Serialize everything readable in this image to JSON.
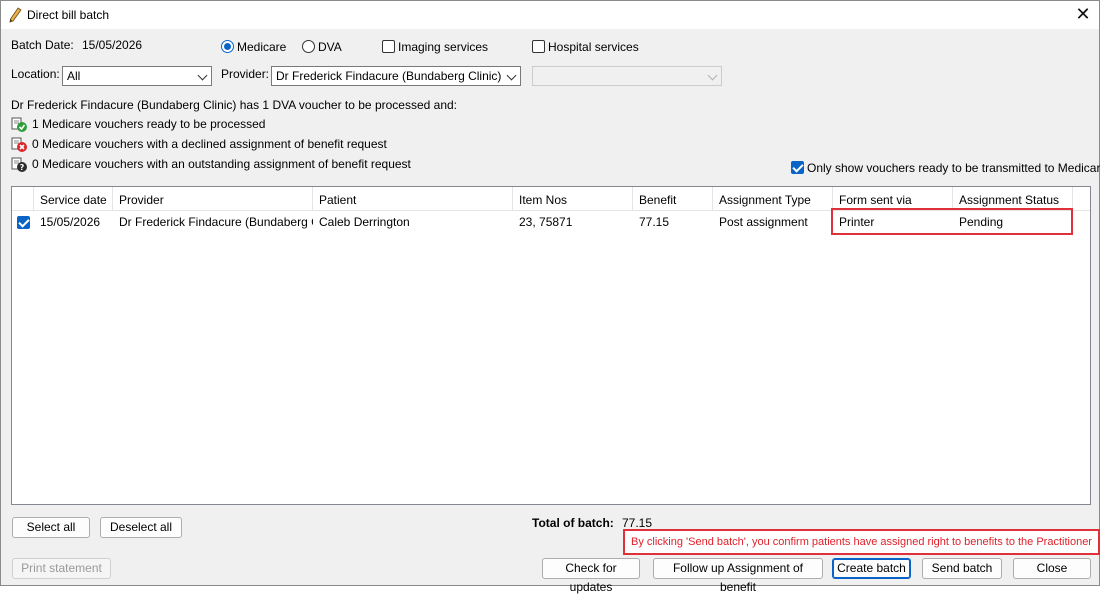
{
  "window": {
    "title": "Direct bill batch"
  },
  "batch": {
    "date_label": "Batch Date:",
    "date_value": "15/05/2026"
  },
  "options": {
    "medicare": "Medicare",
    "dva": "DVA",
    "imaging": "Imaging services",
    "hospital": "Hospital services"
  },
  "location": {
    "label": "Location:",
    "value": "All"
  },
  "provider": {
    "label": "Provider:",
    "value": "Dr Frederick Findacure (Bundaberg Clinic)"
  },
  "summary": {
    "heading": "Dr Frederick Findacure (Bundaberg Clinic) has 1 DVA voucher to be processed and:",
    "ready": "1 Medicare vouchers ready to be processed",
    "declined": "0 Medicare vouchers with a declined assignment of benefit request",
    "outstanding": "0 Medicare vouchers with an outstanding assignment of benefit request"
  },
  "only_show": "Only show vouchers ready to be transmitted to Medicare",
  "table": {
    "columns": [
      "Service date",
      "Provider",
      "Patient",
      "Item Nos",
      "Benefit",
      "Assignment Type",
      "Form sent via",
      "Assignment Status"
    ],
    "rows": [
      {
        "checked": true,
        "service_date": "15/05/2026",
        "provider": "Dr Frederick Findacure (Bundaberg Cl...",
        "patient": "Caleb Derrington",
        "item_nos": "23, 75871",
        "benefit": "77.15",
        "assignment_type": "Post assignment",
        "form_sent_via": "Printer",
        "assignment_status": "Pending"
      }
    ]
  },
  "total": {
    "label": "Total of batch:",
    "value": "77.15"
  },
  "notice": "By clicking 'Send batch', you confirm patients have assigned right to benefits to the Practitioner",
  "buttons": {
    "select_all": "Select all",
    "deselect_all": "Deselect all",
    "print_statement": "Print statement",
    "check_updates": "Check for updates",
    "follow_up": "Follow up Assignment of benefit",
    "create_batch": "Create batch",
    "send_batch": "Send batch",
    "close": "Close"
  },
  "colors": {
    "accent": "#0a64c8",
    "highlight": "#e0303a",
    "ready_icon": "#2e9e3a",
    "declined_icon": "#d8262c"
  }
}
